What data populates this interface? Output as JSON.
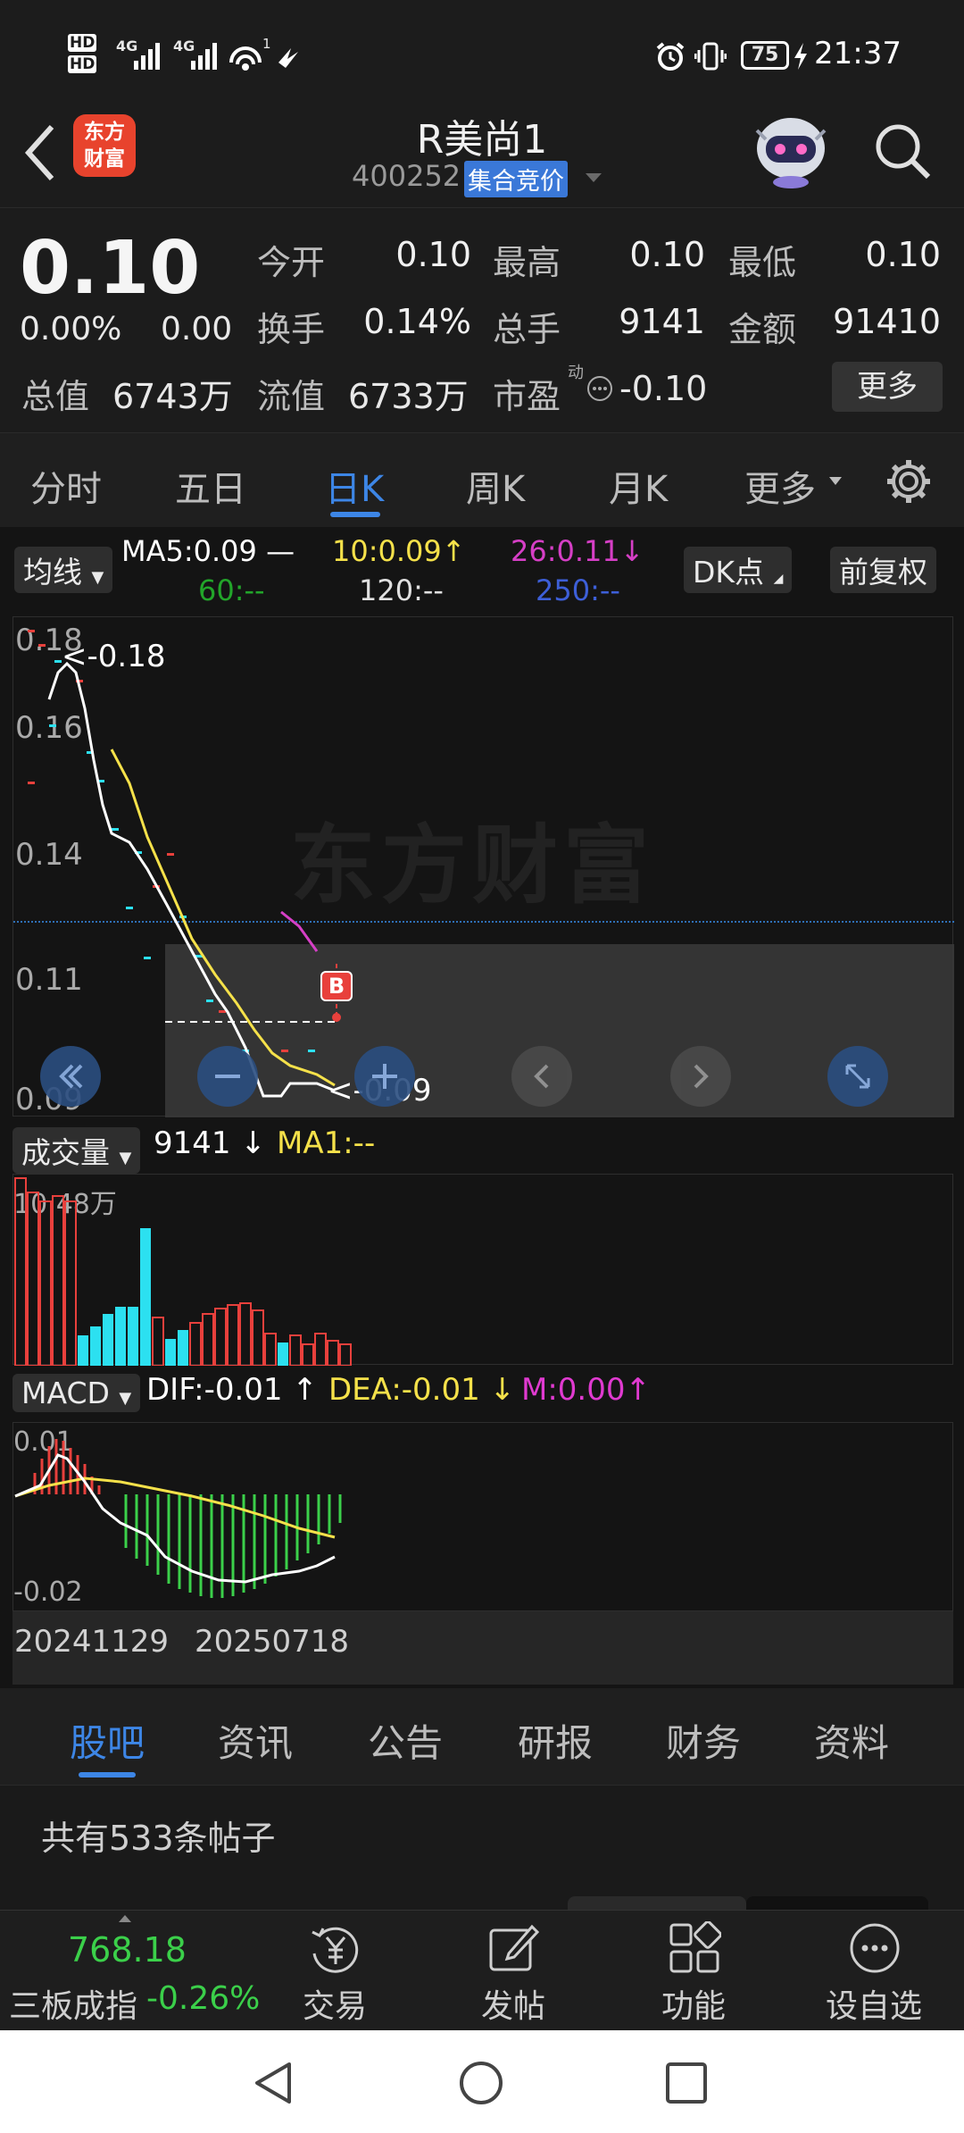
{
  "status": {
    "hd1": "HD",
    "hd2": "HD",
    "sig1": "4G",
    "sig2": "4G",
    "wifi_sub": "1",
    "battery": "75",
    "time": "21:37"
  },
  "header": {
    "brand_line1": "东方",
    "brand_line2": "财富",
    "title": "R美尚1",
    "code": "400252",
    "auction_badge": "集合竞价"
  },
  "quote": {
    "price": "0.10",
    "change_pct": "0.00%",
    "change": "0.00",
    "rows": [
      [
        {
          "label": "今开",
          "value": "0.10"
        },
        {
          "label": "最高",
          "value": "0.10"
        },
        {
          "label": "最低",
          "value": "0.10"
        }
      ],
      [
        {
          "label": "换手",
          "value": "0.14%"
        },
        {
          "label": "总手",
          "value": "9141"
        },
        {
          "label": "金额",
          "value": "91410"
        }
      ]
    ],
    "total_value_label": "总值",
    "total_value": "6743万",
    "float_value_label": "流值",
    "float_value": "6733万",
    "pe_label": "市盈",
    "pe_sup": "动",
    "pe_value": "-0.10",
    "more_button": "更多"
  },
  "ktabs": [
    "分时",
    "五日",
    "日K",
    "周K",
    "月K",
    "更多"
  ],
  "ma_bar": {
    "selector": "均线",
    "ma5": "MA5:0.09",
    "ma10": "10:0.09",
    "ma26": "26:0.11",
    "ma60": "60:--",
    "ma120": "120:--",
    "ma250": "250:--",
    "dk": "DK点",
    "adjust": "前复权"
  },
  "main_chart": {
    "y_ticks": [
      "0.18",
      "0.16",
      "0.14",
      "0.11",
      "0.09"
    ],
    "max_label": "<-0.18",
    "min_label": "<-0.09",
    "marker": "B",
    "watermark": "东方财富"
  },
  "volume": {
    "selector": "成交量",
    "value": "9141",
    "ma1": "MA1:--",
    "max_label": "10.48万"
  },
  "macd": {
    "selector": "MACD",
    "dif": "DIF:-0.01",
    "dea": "DEA:-0.01",
    "m": "M:0.00",
    "top": "0.01",
    "bottom": "-0.02"
  },
  "dates": {
    "start": "20241129",
    "mid": "20250718"
  },
  "bottom_tabs": [
    "股吧",
    "资讯",
    "公告",
    "研报",
    "财务",
    "资料"
  ],
  "posts": {
    "count_text": "共有533条帖子"
  },
  "toolbar": {
    "index_value": "768.18",
    "index_name": "三板成指",
    "index_change": "-0.26%",
    "trade": "交易",
    "post": "发帖",
    "func": "功能",
    "watch": "设自选"
  },
  "colors": {
    "up": "#e8403c",
    "down": "#2ce0f0",
    "accent": "#3d86e6",
    "ma5": "#ffffff",
    "ma10": "#f5e14a",
    "ma26": "#d63fc6",
    "ma60": "#22a52a",
    "ma250": "#3d5fd8"
  }
}
